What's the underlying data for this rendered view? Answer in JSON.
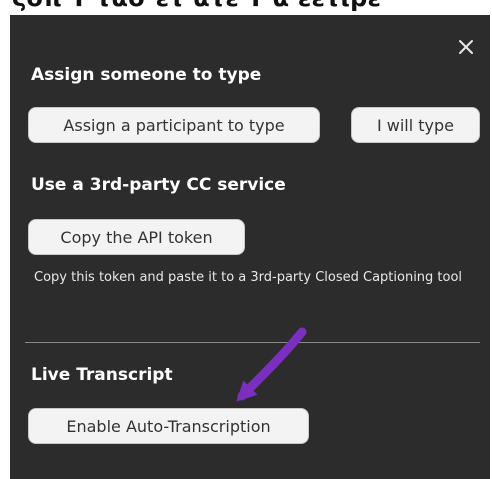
{
  "top_clipped_text": "ζοπ Τ τασ ετ ατε Τ α εετιρε",
  "panel": {
    "close_icon": "close-icon"
  },
  "sections": {
    "assign": {
      "heading": "Assign someone to type",
      "assign_button_label": "Assign a participant to type",
      "i_will_type_button_label": "I will type"
    },
    "third_party": {
      "heading": "Use a 3rd-party CC service",
      "copy_button_label": "Copy the API token",
      "description": "Copy this token and paste it to a 3rd-party Closed Captioning tool"
    },
    "live_transcript": {
      "heading": "Live Transcript",
      "enable_button_label": "Enable Auto-Transcription"
    }
  },
  "annotation": {
    "arrow_color": "#7b2fbf",
    "arrow_icon": "arrow-annotation"
  },
  "colors": {
    "panel_background": "#2c2c2c",
    "heading_text": "#ffffff",
    "button_background": "#f3f3f3",
    "button_text": "#333333",
    "divider": "#8a8a8a"
  }
}
